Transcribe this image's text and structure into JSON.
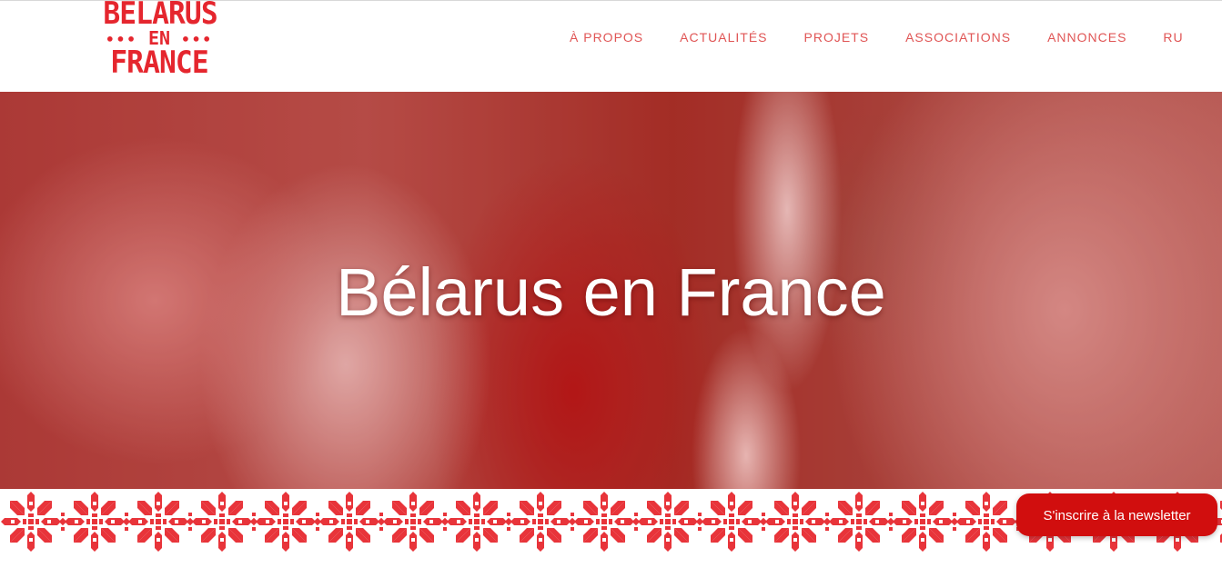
{
  "brand": {
    "logo_line1": "BÉLARUS",
    "logo_dots_left": "•••",
    "logo_line2": "EN",
    "logo_dots_right": "•••",
    "logo_line3": "FRANCE",
    "color": "#e5262e"
  },
  "nav": {
    "items": [
      {
        "label": "À PROPOS"
      },
      {
        "label": "ACTUALITÉS"
      },
      {
        "label": "PROJETS"
      },
      {
        "label": "ASSOCIATIONS"
      },
      {
        "label": "ANNONCES"
      },
      {
        "label": "RU"
      }
    ],
    "color": "#e05555"
  },
  "hero": {
    "title": "Bélarus en France"
  },
  "ornament": {
    "icon": "belarusian-ornament-pattern",
    "color": "#e8343a"
  },
  "newsletter": {
    "label": "S'inscrire à la newsletter",
    "color": "#d10e0e"
  }
}
